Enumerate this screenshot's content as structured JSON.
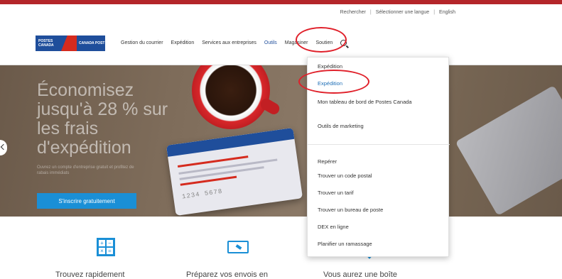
{
  "utility_bar": {
    "items": [
      "Rechercher",
      "Sélectionner une langue",
      "English"
    ]
  },
  "logo": {
    "left_text": "POSTES CANADA",
    "right_text": "CANADA POST"
  },
  "nav": {
    "items": [
      {
        "label": "Gestion du courrier"
      },
      {
        "label": "Expédition"
      },
      {
        "label": "Services aux entreprises"
      },
      {
        "label": "Outils"
      },
      {
        "label": "Magasiner"
      },
      {
        "label": "Soutien"
      }
    ]
  },
  "hero": {
    "headline": "Économisez jusqu'à 28 % sur les frais d'expédition",
    "subtext": "Ouvrez un compte d'entreprise gratuit et profitez de rabais immédiats",
    "button_label": "S'inscrire gratuitement"
  },
  "card": {
    "number": "1234 5678"
  },
  "dropdown": {
    "group1": [
      {
        "label": "Expédition"
      },
      {
        "label": "Expédition"
      },
      {
        "label": "Mon tableau de bord de Postes Canada"
      },
      {
        "label": "Outils de marketing"
      }
    ],
    "group2_heading": "Repérer",
    "group2": [
      {
        "label": "Trouver un code postal"
      },
      {
        "label": "Trouver un tarif"
      },
      {
        "label": "Trouver un bureau de poste"
      },
      {
        "label": "DEX en ligne"
      },
      {
        "label": "Planifier un ramassage"
      }
    ]
  },
  "features": [
    {
      "text": "Trouvez rapidement"
    },
    {
      "text": "Préparez vos envois en"
    },
    {
      "text": "Vous aurez une boîte"
    }
  ],
  "colors": {
    "brand_blue": "#1f4e9b",
    "brand_red": "#d52b1e",
    "cta_blue": "#1a8fd6",
    "annotation_red": "#e0202a"
  }
}
